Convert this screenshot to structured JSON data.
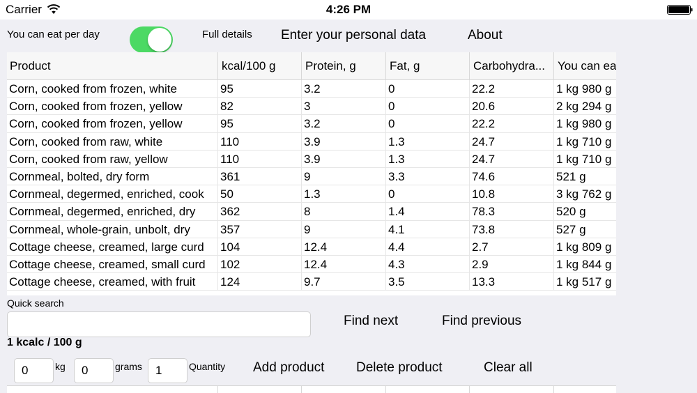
{
  "status_bar": {
    "carrier": "Carrier",
    "time": "4:26 PM"
  },
  "top_bar": {
    "eat_per_day_label": "You can eat per day",
    "toggle_on": true,
    "full_details_label": "Full details",
    "personal_data_button": "Enter your personal data",
    "about_button": "About"
  },
  "table": {
    "columns": [
      "Product",
      "kcal/100 g",
      "Protein, g",
      "Fat, g",
      "Carbohydra...",
      "You can eat"
    ],
    "rows": [
      [
        "Corn, cooked from frozen, white",
        "95",
        "3.2",
        "0",
        "22.2",
        "1 kg 980 g"
      ],
      [
        "Corn, cooked from frozen, yellow",
        "82",
        "3",
        "0",
        "20.6",
        "2 kg 294 g"
      ],
      [
        "Corn, cooked from frozen, yellow",
        "95",
        "3.2",
        "0",
        "22.2",
        "1 kg 980 g"
      ],
      [
        "Corn, cooked from raw, white",
        "110",
        "3.9",
        "1.3",
        "24.7",
        "1 kg 710 g"
      ],
      [
        "Corn, cooked from raw, yellow",
        "110",
        "3.9",
        "1.3",
        "24.7",
        "1 kg 710 g"
      ],
      [
        "Cornmeal, bolted, dry form",
        "361",
        "9",
        "3.3",
        "74.6",
        "521 g"
      ],
      [
        "Cornmeal, degermed, enriched, cook",
        "50",
        "1.3",
        "0",
        "10.8",
        "3 kg 762 g"
      ],
      [
        "Cornmeal, degermed, enriched, dry",
        "362",
        "8",
        "1.4",
        "78.3",
        "520 g"
      ],
      [
        "Cornmeal, whole-grain, unbolt, dry",
        "357",
        "9",
        "4.1",
        "73.8",
        "527 g"
      ],
      [
        "Cottage cheese, creamed, large curd",
        "104",
        "12.4",
        "4.4",
        "2.7",
        "1 kg 809 g"
      ],
      [
        "Cottage cheese, creamed, small curd",
        "102",
        "12.4",
        "4.3",
        "2.9",
        "1 kg 844 g"
      ],
      [
        "Cottage cheese, creamed, with fruit",
        "124",
        "9.7",
        "3.5",
        "13.3",
        "1 kg 517 g"
      ]
    ]
  },
  "search": {
    "label": "Quick search",
    "value": "",
    "find_next": "Find next",
    "find_previous": "Find previous"
  },
  "summary": {
    "kcal_label": "1 kcalc / 100 g"
  },
  "entry": {
    "kg_value": "0",
    "kg_unit": "kg",
    "grams_value": "0",
    "grams_unit": "grams",
    "quantity_value": "1",
    "quantity_label": "Quantity",
    "add_button": "Add product",
    "delete_button": "Delete product",
    "clear_button": "Clear all"
  }
}
